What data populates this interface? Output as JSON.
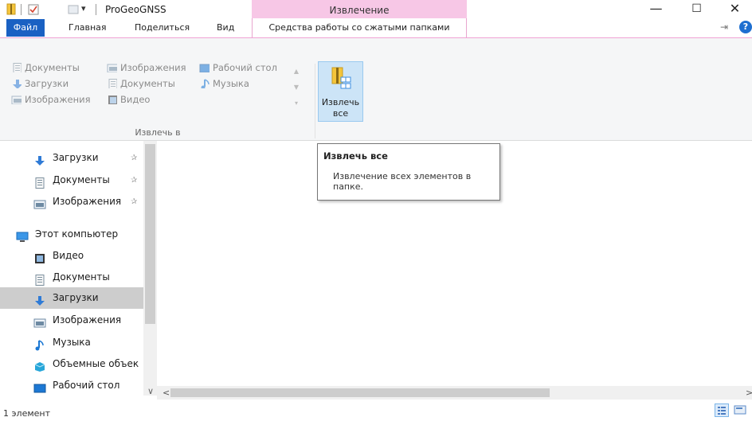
{
  "window": {
    "title": "ProGeoGNSS",
    "context_group": "Извлечение",
    "minimize": "—",
    "maximize": "☐",
    "close": "✕"
  },
  "quick_access": {
    "dropdown": "▾"
  },
  "tabs": {
    "file": "Файл",
    "home": "Главная",
    "share": "Поделиться",
    "view": "Вид",
    "compressed_tools": "Средства работы со сжатыми папками"
  },
  "ribbon": {
    "gallery": [
      [
        "Документы",
        "Изображения",
        "Рабочий стол"
      ],
      [
        "Загрузки",
        "Документы",
        "Музыка"
      ],
      [
        "Изображения",
        "Видео",
        ""
      ]
    ],
    "group_label": "Извлечь в",
    "extract_all_label_line1": "Извлечь",
    "extract_all_label_line2": "все"
  },
  "tooltip": {
    "title": "Извлечь все",
    "body": "Извлечение всех элементов в папке."
  },
  "nav": {
    "items": [
      {
        "label": "Загрузки",
        "icon": "downloads-icon",
        "pinned": true
      },
      {
        "label": "Документы",
        "icon": "documents-icon",
        "pinned": true
      },
      {
        "label": "Изображения",
        "icon": "pictures-icon",
        "pinned": true
      },
      {
        "label": "Этот компьютер",
        "icon": "this-pc-icon",
        "pinned": false
      },
      {
        "label": "Видео",
        "icon": "videos-icon",
        "pinned": false
      },
      {
        "label": "Документы",
        "icon": "documents-icon",
        "pinned": false
      },
      {
        "label": "Загрузки",
        "icon": "downloads-icon",
        "pinned": false,
        "selected": true
      },
      {
        "label": "Изображения",
        "icon": "pictures-icon",
        "pinned": false
      },
      {
        "label": "Музыка",
        "icon": "music-icon",
        "pinned": false
      },
      {
        "label": "Объемные объек",
        "icon": "3d-objects-icon",
        "pinned": false
      },
      {
        "label": "Рабочий стол",
        "icon": "desktop-icon",
        "pinned": false
      }
    ]
  },
  "status": {
    "item_count": "1 элемент"
  },
  "colors": {
    "file_tab": "#1a61c3",
    "context_header": "#f7c7e6",
    "selection": "#cdcdcd"
  }
}
